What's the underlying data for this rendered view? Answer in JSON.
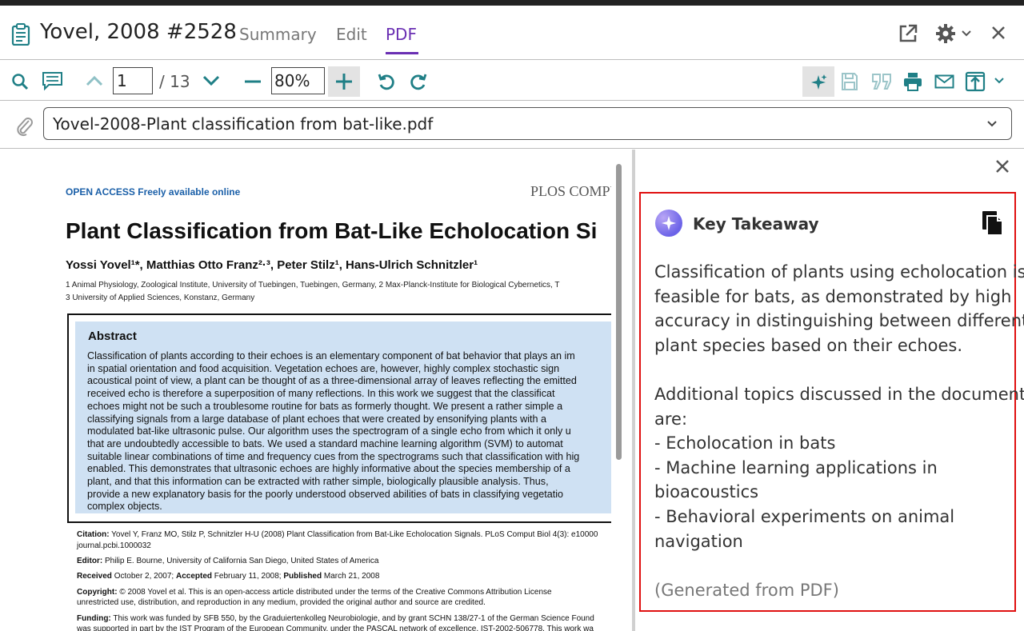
{
  "window": {
    "title": "Yovel, 2008 #2528",
    "tabs": [
      {
        "label": "Summary"
      },
      {
        "label": "Edit"
      },
      {
        "label": "PDF"
      }
    ]
  },
  "toolbar": {
    "page_value": "1",
    "page_total": "/ 13",
    "zoom_value": "80%"
  },
  "file": {
    "name": "Yovel-2008-Plant classification from bat-like.pdf"
  },
  "pdf": {
    "open_access": "OPEN ACCESS Freely available online",
    "journal": "PLOS COMPUTA",
    "title": "Plant Classification from Bat-Like Echolocation Si",
    "authors": "Yossi Yovel¹*, Matthias Otto Franz²·³, Peter Stilz¹, Hans-Ulrich Schnitzler¹",
    "affiliation_1": "1 Animal Physiology, Zoological Institute, University of Tuebingen, Tuebingen, Germany, 2 Max-Planck-Institute for Biological Cybernetics, T",
    "affiliation_2": "3 University of Applied Sciences, Konstanz, Germany",
    "abstract_heading": "Abstract",
    "abstract_lines": [
      "Classification of plants according to their echoes is an elementary component of bat behavior that plays an im",
      "in spatial orientation and food acquisition. Vegetation echoes are, however, highly complex stochastic sign",
      "acoustical point of view, a plant can be thought of as a three-dimensional array of leaves reflecting the emitted",
      "received echo is therefore a superposition of many reflections. In this work we suggest that the classificat",
      "echoes might not be such a troublesome routine for bats as formerly thought. We present a rather simple a",
      "classifying signals from a large database of plant echoes that were created by ensonifying plants with a",
      "modulated bat-like ultrasonic pulse. Our algorithm uses the spectrogram of a single echo from which it only u",
      "that are undoubtedly accessible to bats. We used a standard machine learning algorithm (SVM) to automat",
      "suitable linear combinations of time and frequency cues from the spectrograms such that classification with hig",
      "enabled. This demonstrates that ultrasonic echoes are highly informative about the species membership of a",
      "plant, and that this information can be extracted with rather simple, biologically plausible analysis. Thus,",
      "provide a new explanatory basis for the poorly understood observed abilities of bats in classifying vegetatio",
      "complex objects."
    ],
    "citation_label": "Citation:",
    "citation_text": " Yovel Y, Franz MO, Stilz P, Schnitzler H-U (2008) Plant Classification from Bat-Like Echolocation Signals. PLoS Comput Biol  4(3): e10000",
    "citation_text_2": "journal.pcbi.1000032",
    "editor_label": "Editor:",
    "editor_text": " Philip E. Bourne, University of California San Diego, United States of America",
    "received_label": "Received",
    "received_text": " October 2, 2007; ",
    "accepted_label": "Accepted",
    "accepted_text": " February 11, 2008; ",
    "published_label": "Published",
    "published_text": " March 21, 2008",
    "copyright_label": "Copyright:",
    "copyright_text": " © 2008 Yovel et al. This is an open-access article distributed under the terms of the Creative Commons Attribution License",
    "copyright_text_2": "unrestricted use, distribution, and reproduction in any medium, provided the original author and source are credited.",
    "funding_label": "Funding:",
    "funding_text": " This work was funded by SFB 550, by the Graduiertenkolleg Neurobiologie, and by grant SCHN 138/27-1 of the German Science Found",
    "funding_text_2": "was supported in part by the IST Program of the European Community, under the PASCAL network of excellence, IST-2002-506778. This work wa"
  },
  "key_takeaway": {
    "title": "Key Takeaway",
    "summary_lines": [
      "Classification of plants using echolocation is",
      "feasible for bats, as demonstrated by high",
      "accuracy in distinguishing between different",
      "plant species based on their echoes."
    ],
    "topics_lines": [
      "Additional topics discussed in the document",
      "are:",
      "- Echolocation in bats",
      "- Machine learning applications in",
      "bioacoustics",
      "- Behavioral experiments on animal",
      "navigation"
    ],
    "generated_note": "(Generated from PDF)"
  },
  "colors": {
    "accent_purple": "#6a2fb3",
    "toolbar_teal": "#1f7f86",
    "highlight_red": "#e01010",
    "abstract_bg": "#cfe1f3"
  },
  "icons": [
    "clipboard-icon",
    "open-external-icon",
    "gear-icon",
    "chevron-down-icon",
    "close-icon",
    "search-icon",
    "comment-icon",
    "chevron-up-icon",
    "minus-icon",
    "plus-icon",
    "rotate-left-icon",
    "rotate-right-icon",
    "sparkle-icon",
    "save-icon",
    "quote-icon",
    "print-icon",
    "email-icon",
    "export-icon",
    "paperclip-icon",
    "copy-icon"
  ]
}
